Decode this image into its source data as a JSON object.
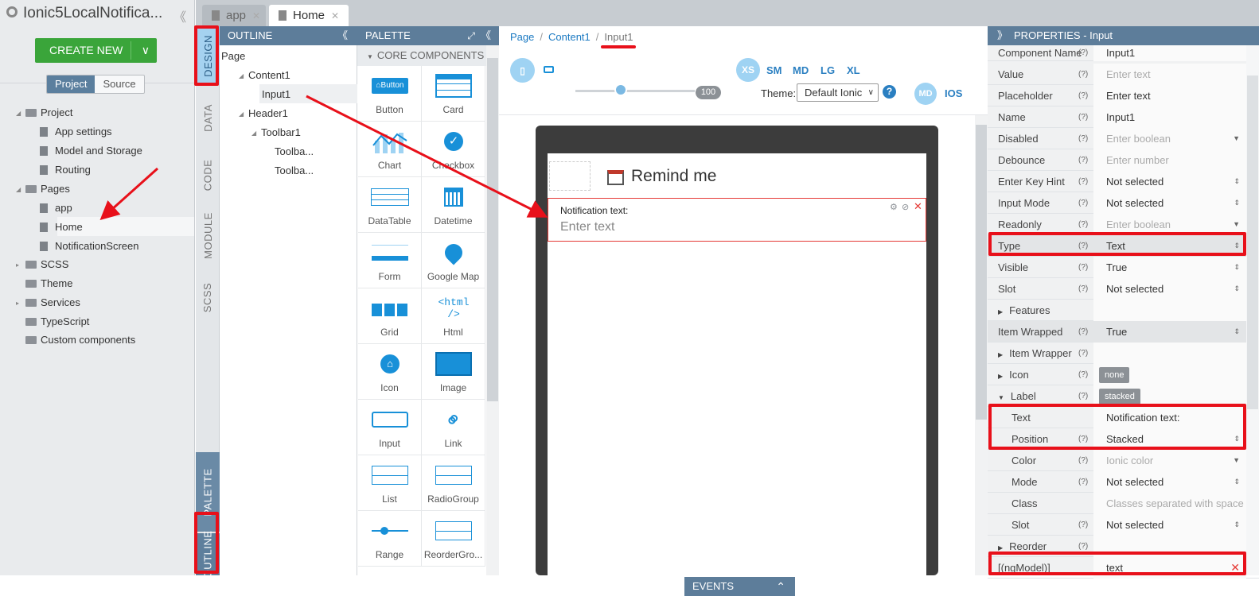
{
  "app_title": "Ionic5LocalNotifica...",
  "create_new_label": "CREATE NEW",
  "project_tabs": [
    "Project",
    "Source"
  ],
  "project_tree": [
    {
      "label": "Project",
      "type": "folder"
    },
    {
      "label": "App settings",
      "type": "settings"
    },
    {
      "label": "Model and Storage",
      "type": "settings"
    },
    {
      "label": "Routing",
      "type": "settings"
    },
    {
      "label": "Pages",
      "type": "folder"
    },
    {
      "label": "app",
      "type": "page"
    },
    {
      "label": "Home",
      "type": "page"
    },
    {
      "label": "NotificationScreen",
      "type": "page"
    },
    {
      "label": "SCSS",
      "type": "folder"
    },
    {
      "label": "Theme",
      "type": "folder"
    },
    {
      "label": "Services",
      "type": "folder"
    },
    {
      "label": "TypeScript",
      "type": "folder"
    },
    {
      "label": "Custom components",
      "type": "folder"
    }
  ],
  "editor_tabs": [
    {
      "label": "app"
    },
    {
      "label": "Home"
    }
  ],
  "vertical_tabs": [
    "DESIGN",
    "DATA",
    "CODE",
    "MODULE",
    "SCSS",
    "PALETTE",
    "OUTLINE"
  ],
  "outline": {
    "title": "OUTLINE",
    "items": [
      "Page",
      "Content1",
      "Input1",
      "Header1",
      "Toolbar1",
      "Toolba...",
      "Toolba..."
    ]
  },
  "palette": {
    "title": "PALETTE",
    "section": "CORE COMPONENTS",
    "items": [
      "Button",
      "Card",
      "Chart",
      "Checkbox",
      "DataTable",
      "Datetime",
      "Form",
      "Google Map",
      "Grid",
      "Html",
      "Icon",
      "Image",
      "Input",
      "Link",
      "List",
      "RadioGroup",
      "Range",
      "ReorderGro..."
    ]
  },
  "breadcrumb": [
    "Page",
    "Content1",
    "Input1"
  ],
  "toolbar": {
    "zoom": "100",
    "breakpoints": [
      "XS",
      "SM",
      "MD",
      "LG",
      "XL"
    ],
    "theme_label": "Theme:",
    "theme_value": "Default Ionic",
    "modes": [
      "MD",
      "IOS"
    ]
  },
  "preview": {
    "header_title": "Remind me",
    "input_label": "Notification text:",
    "input_placeholder": "Enter text"
  },
  "events_label": "EVENTS",
  "properties": {
    "title": "PROPERTIES - Input",
    "rows": [
      {
        "name": "Component Name",
        "value": "Input1"
      },
      {
        "name": "Value",
        "value": "Enter text"
      },
      {
        "name": "Placeholder",
        "value": "Enter text"
      },
      {
        "name": "Name",
        "value": "Input1"
      },
      {
        "name": "Disabled",
        "value": "Enter boolean"
      },
      {
        "name": "Debounce",
        "value": "Enter number"
      },
      {
        "name": "Enter Key Hint",
        "value": "Not selected"
      },
      {
        "name": "Input Mode",
        "value": "Not selected"
      },
      {
        "name": "Readonly",
        "value": "Enter boolean"
      },
      {
        "name": "Type",
        "value": "Text"
      },
      {
        "name": "Visible",
        "value": "True"
      },
      {
        "name": "Slot",
        "value": "Not selected"
      },
      {
        "name": "Features",
        "value": ""
      },
      {
        "name": "Item Wrapped",
        "value": "True"
      },
      {
        "name": "Item Wrapper",
        "value": ""
      },
      {
        "name": "Icon",
        "value": "none"
      },
      {
        "name": "Label",
        "value": "stacked"
      },
      {
        "name": "Text",
        "value": "Notification text:"
      },
      {
        "name": "Position",
        "value": "Stacked"
      },
      {
        "name": "Color",
        "value": "Ionic color"
      },
      {
        "name": "Mode",
        "value": "Not selected"
      },
      {
        "name": "Class",
        "value": "Classes separated with space"
      },
      {
        "name": "Slot",
        "value": "Not selected"
      },
      {
        "name": "Reorder",
        "value": ""
      },
      {
        "name": "[(ngModel)]",
        "value": "text"
      }
    ]
  }
}
